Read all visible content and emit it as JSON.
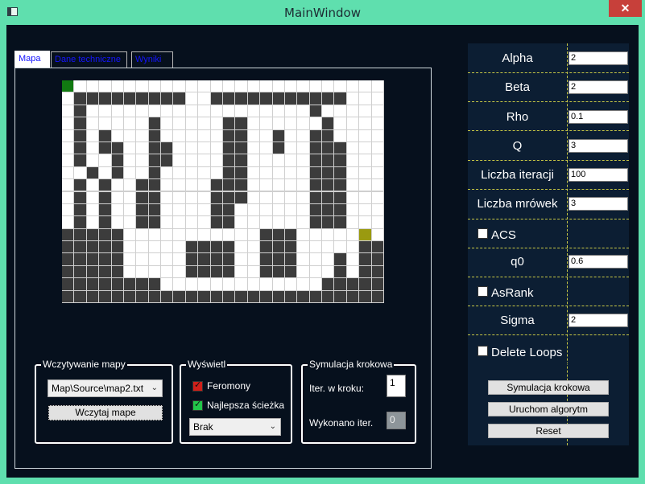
{
  "window": {
    "title": "MainWindow",
    "close_glyph": "✕",
    "accent": "#5fdfae",
    "background": "#06101d"
  },
  "tabs": [
    {
      "label": "Mapa",
      "active": true
    },
    {
      "label": "Dane techniczne",
      "active": false
    },
    {
      "label": "Wyniki",
      "active": false
    }
  ],
  "map": {
    "rows": 18,
    "cols": 26,
    "colors": {
      "wall": "#3c3c3c",
      "free": "#ffffff",
      "start": "#117a11",
      "goal": "#9a9a10"
    },
    "cells": [
      "S.........................",
      ".#########..###########...",
      ".#..................#.....",
      ".#.....#.....##......#....",
      ".#.#...#.....##..#..##....",
      ".#.##..##....##..#..###...",
      ".#..#..##....##.....###...",
      "..#.#..#.....##.....###...",
      ".#.#..##....###.....###...",
      ".#.#..##....###.....###...",
      ".#.#..##....##......###...",
      ".#.#..##....##......###...",
      "#####...........###.....G.",
      "#####.....####..###.....##",
      "#####.....####..###...#.##",
      "#####.....####..###...#.##",
      "########.............#####",
      "##########################"
    ]
  },
  "load_group": {
    "title": "Wczytywanie mapy",
    "file_value": "Map\\Source\\map2.txt",
    "load_button": "Wczytaj mape"
  },
  "display_group": {
    "title": "Wyświetl",
    "pheromones_label": "Feromony",
    "best_path_label": "Najlepsza ścieżka",
    "select_value": "Brak"
  },
  "step_group": {
    "title": "Symulacja krokowa",
    "iter_label": "Iter. w kroku:",
    "iter_value": "1",
    "done_label": "Wykonano iter.",
    "done_value": "0"
  },
  "params": {
    "alpha": {
      "label": "Alpha",
      "value": "2"
    },
    "beta": {
      "label": "Beta",
      "value": "2"
    },
    "rho": {
      "label": "Rho",
      "value": "0.1"
    },
    "q": {
      "label": "Q",
      "value": "3"
    },
    "iterations": {
      "label": "Liczba iteracji",
      "value": "100"
    },
    "ants": {
      "label": "Liczba mrówek",
      "value": "3"
    },
    "acs": {
      "label": "ACS",
      "checked": false
    },
    "q0": {
      "label": "q0",
      "value": "0.6"
    },
    "asrank": {
      "label": "AsRank",
      "checked": false
    },
    "sigma": {
      "label": "Sigma",
      "value": "2"
    },
    "delete_loops": {
      "label": "Delete Loops",
      "checked": false
    }
  },
  "buttons": {
    "step_sim": "Symulacja krokowa",
    "run": "Uruchom algorytm",
    "reset": "Reset"
  }
}
